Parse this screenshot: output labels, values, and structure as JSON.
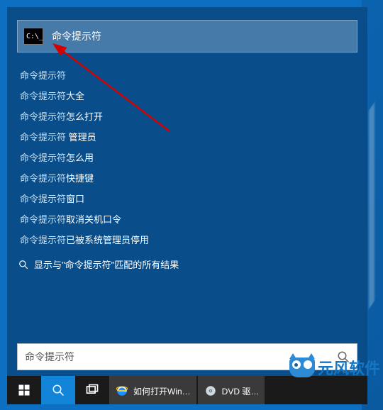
{
  "search_panel": {
    "top_result": {
      "label": "命令提示符",
      "icon_text": "C:\\_"
    },
    "suggestions": [
      {
        "prefix": "命令提示符",
        "suffix": ""
      },
      {
        "prefix": "命令提示符",
        "suffix": "大全"
      },
      {
        "prefix": "命令提示符",
        "suffix": "怎么打开"
      },
      {
        "prefix": "命令提示符",
        "suffix": " 管理员"
      },
      {
        "prefix": "命令提示符",
        "suffix": "怎么用"
      },
      {
        "prefix": "命令提示符",
        "suffix": "快捷键"
      },
      {
        "prefix": "命令提示符",
        "suffix": "窗口"
      },
      {
        "prefix": "命令提示符",
        "suffix": "取消关机口令"
      },
      {
        "prefix": "命令提示符",
        "suffix": "已被系统管理员停用"
      }
    ],
    "show_all": {
      "pre": "显示与\"",
      "query": "命令提示符",
      "post": "\"匹配的所有结果"
    },
    "search_box": {
      "value": "命令提示符"
    }
  },
  "taskbar": {
    "apps": [
      {
        "label": "如何打开Win…",
        "icon": "ie"
      },
      {
        "label": "DVD 驱…",
        "icon": "disc"
      }
    ]
  },
  "watermark": {
    "text": "元风软件"
  }
}
